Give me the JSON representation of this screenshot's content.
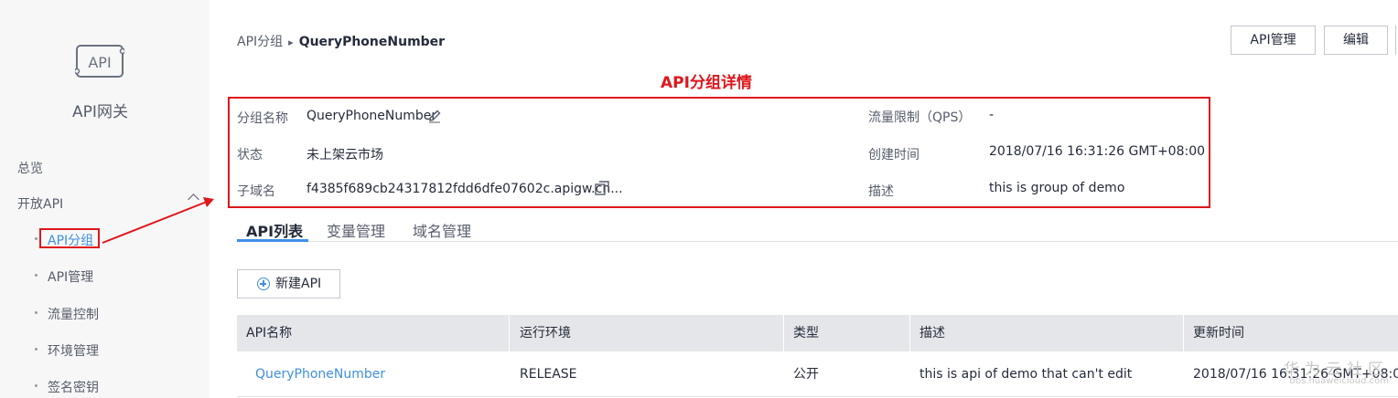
{
  "sidebar": {
    "logo_mark": "API",
    "title": "API网关",
    "overview": "总览",
    "open_api": "开放API",
    "items": [
      {
        "label": "API分组"
      },
      {
        "label": "API管理"
      },
      {
        "label": "流量控制"
      },
      {
        "label": "环境管理"
      },
      {
        "label": "签名密钥"
      }
    ]
  },
  "breadcrumb": {
    "parent": "API分组",
    "current": "QueryPhoneNumber"
  },
  "toolbar": {
    "api_manage_label": "API管理",
    "edit_label": "编辑"
  },
  "annotation": "API分组详情",
  "details": {
    "group_name_label": "分组名称",
    "group_name_value": "QueryPhoneNumber",
    "status_label": "状态",
    "status_value": "未上架云市场",
    "subdomain_label": "子域名",
    "subdomain_value": "f4385f689cb24317812fdd6dfe07602c.apigw.cn...",
    "qps_label": "流量限制（QPS）",
    "qps_value": "-",
    "created_label": "创建时间",
    "created_value": "2018/07/16 16:31:26 GMT+08:00",
    "desc_label": "描述",
    "desc_value": "this is group of demo"
  },
  "tabs": [
    {
      "label": "API列表"
    },
    {
      "label": "变量管理"
    },
    {
      "label": "域名管理"
    }
  ],
  "new_api_label": "新建API",
  "table": {
    "headers": [
      "API名称",
      "运行环境",
      "类型",
      "描述",
      "更新时间"
    ],
    "rows": [
      [
        "QueryPhoneNumber",
        "RELEASE",
        "公开",
        "this is api of demo that can't edit",
        "2018/07/16 16:31:26 GMT+08:00"
      ]
    ]
  },
  "watermark": {
    "line1": "华为云社区",
    "line2": "bbs.huaweicloud.com"
  },
  "colors": {
    "accent": "#3f8fe6",
    "annotation_red": "#e0161b"
  }
}
